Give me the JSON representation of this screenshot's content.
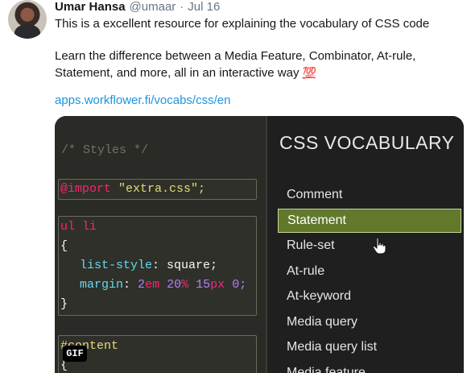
{
  "tweet": {
    "author_name": "Umar Hansa",
    "handle": "@umaar",
    "separator": "·",
    "date": "Jul 16",
    "line1": "This is a excellent resource for explaining the vocabulary of CSS code",
    "line2": "Learn the difference between a Media Feature, Combinator, At-rule,",
    "line3": "Statement, and more, all in an interactive way",
    "emoji": "💯",
    "link": "apps.workflower.fi/vocabs/css/en"
  },
  "media": {
    "gif_badge": "GIF",
    "code": {
      "comment": "/* Styles */",
      "import_kw": "@import",
      "import_str": "\"extra.css\";",
      "selector": "ul li",
      "open_brace": "{",
      "prop1": "list-style",
      "colon1": ":",
      "val1": "square;",
      "prop2": "margin",
      "colon2": ":",
      "v2a": "2",
      "u2a": "em",
      "v2b": "20",
      "u2b": "%",
      "v2c": "15",
      "u2c": "px",
      "v2d": "0;",
      "close_brace": "}",
      "selector2": "#content",
      "open_brace2": "{"
    },
    "vocab": {
      "title": "CSS VOCABULARY",
      "items": [
        "Comment",
        "Statement",
        "Rule-set",
        "At-rule",
        "At-keyword",
        "Media query",
        "Media query list",
        "Media feature"
      ],
      "active_index": 1
    }
  },
  "colors": {
    "accent_active": "#62792b",
    "link": "#1b95e0"
  }
}
